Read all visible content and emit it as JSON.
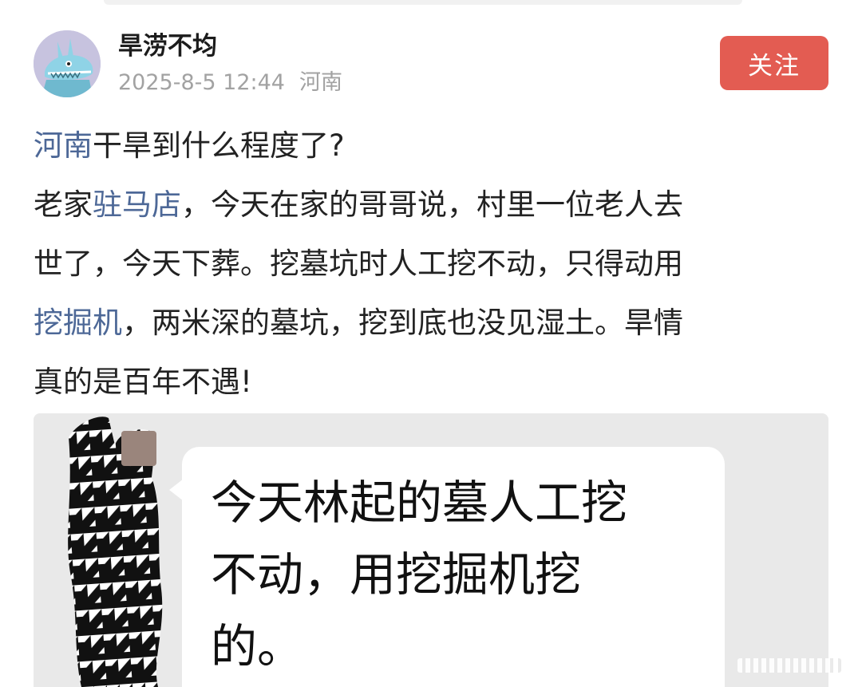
{
  "post": {
    "author": {
      "name": "旱涝不均",
      "avatar_icon": "blue-monster-avatar-icon",
      "time": "2025-8-5 12:44",
      "location": "河南"
    },
    "follow_label": "关注",
    "body": {
      "line1": {
        "link": "河南",
        "text": "干旱到什么程度了?"
      },
      "line2": {
        "pre": "老家",
        "link": "驻马店",
        "post": "，今天在家的哥哥说，村里一位老人去"
      },
      "line3": {
        "text": "世了，今天下葬。挖墓坑时人工挖不动，只得动用"
      },
      "line4": {
        "link": "挖掘机",
        "text": "，两米深的墓坑，挖到底也没见湿土。旱情"
      },
      "line5": {
        "text": "真的是百年不遇!"
      }
    },
    "image": {
      "bubble_lines": [
        "今天林起的墓人工挖",
        "不动，用挖掘机挖",
        "的。"
      ]
    }
  },
  "colors": {
    "follow_button": "#e35c52",
    "link": "#4d6897",
    "meta_text": "#a2a2a2",
    "image_background": "#e9e9e9"
  }
}
